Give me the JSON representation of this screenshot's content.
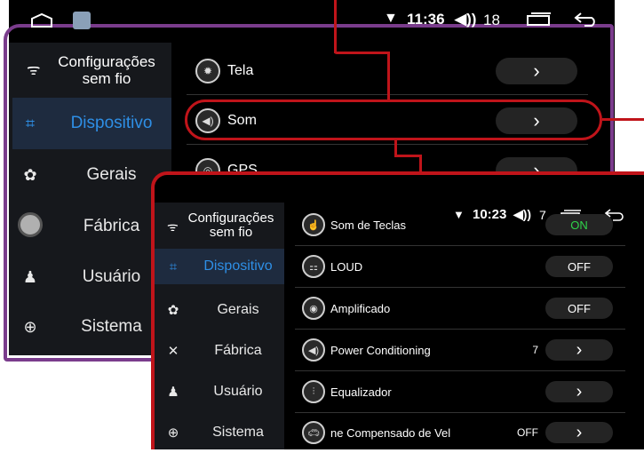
{
  "back_screen": {
    "status": {
      "time": "11:36",
      "volume": "18"
    },
    "sidebar": {
      "header": "Configurações\nsem fio",
      "items": [
        {
          "label": "Dispositivo",
          "icon": "device-icon",
          "active": true
        },
        {
          "label": "Gerais",
          "icon": "gear-icon",
          "active": false
        },
        {
          "label": "Fábrica",
          "icon": "wrench-icon",
          "active": false
        },
        {
          "label": "Usuário",
          "icon": "user-icon",
          "active": false
        },
        {
          "label": "Sistema",
          "icon": "globe-icon",
          "active": false
        }
      ]
    },
    "rows": [
      {
        "label": "Tela",
        "icon": "brightness-icon"
      },
      {
        "label": "Som",
        "icon": "speaker-icon"
      },
      {
        "label": "GPS",
        "icon": "gps-icon"
      }
    ]
  },
  "front_screen": {
    "status": {
      "time": "10:23",
      "volume": "7"
    },
    "sidebar": {
      "header": "Configurações\nsem fio",
      "items": [
        {
          "label": "Dispositivo",
          "icon": "device-icon",
          "active": true
        },
        {
          "label": "Gerais",
          "icon": "gear-icon",
          "active": false
        },
        {
          "label": "Fábrica",
          "icon": "tools-icon",
          "active": false
        },
        {
          "label": "Usuário",
          "icon": "user-icon",
          "active": false
        },
        {
          "label": "Sistema",
          "icon": "globe-icon",
          "active": false
        }
      ]
    },
    "rows": [
      {
        "label": "Som de Teclas",
        "control": "toggle",
        "value": "ON",
        "icon": "touch-icon"
      },
      {
        "label": "LOUD",
        "control": "toggle",
        "value": "OFF",
        "icon": "loud-icon"
      },
      {
        "label": "Amplificado",
        "control": "toggle",
        "value": "OFF",
        "icon": "amplifier-icon"
      },
      {
        "label": "Power Conditioning",
        "control": "arrow",
        "value": "7",
        "icon": "speaker-icon"
      },
      {
        "label": "Equalizador",
        "control": "arrow",
        "value": "",
        "icon": "equalizer-icon"
      },
      {
        "label": "ne Compensado de Vel",
        "control": "arrow",
        "value": "OFF",
        "icon": "car-speed-icon"
      }
    ]
  },
  "colors": {
    "accent_blue": "#2e8fe6",
    "frame_purple": "#7a3c8c",
    "frame_red": "#c0141a",
    "on_green": "#2fd34a"
  }
}
